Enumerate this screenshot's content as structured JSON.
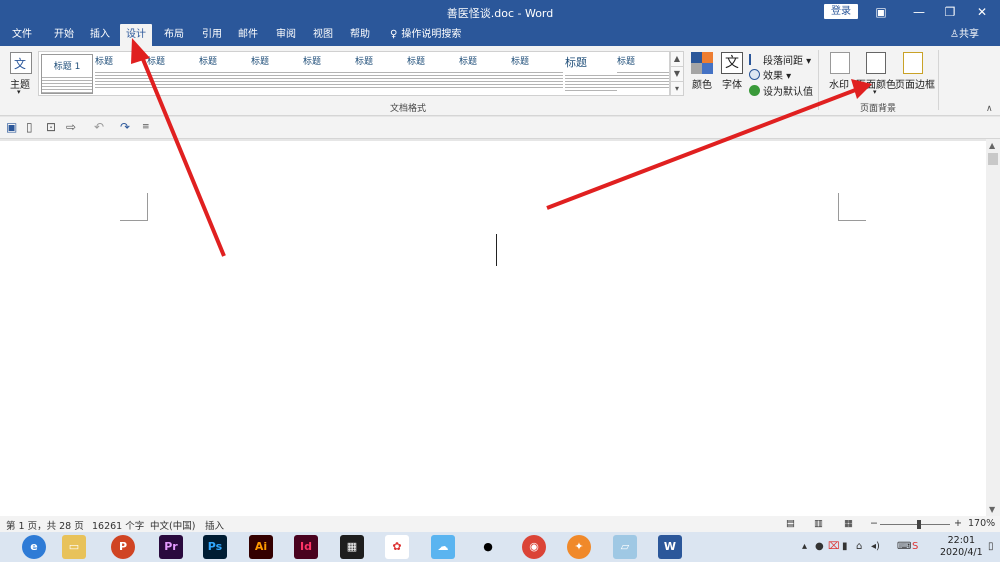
{
  "window": {
    "title": "善医怪谈.doc - Word",
    "login_label": "登录",
    "share_label": "共享"
  },
  "tabs": [
    {
      "label": "文件"
    },
    {
      "label": "开始"
    },
    {
      "label": "插入"
    },
    {
      "label": "设计"
    },
    {
      "label": "布局"
    },
    {
      "label": "引用"
    },
    {
      "label": "邮件"
    },
    {
      "label": "审阅"
    },
    {
      "label": "视图"
    },
    {
      "label": "帮助"
    },
    {
      "label": "操作说明搜索"
    }
  ],
  "active_tab": "设计",
  "ribbon": {
    "theme_label": "主题",
    "document_format_label": "文档格式",
    "style_headings": [
      "标题 1",
      "标题",
      "标题",
      "标题",
      "标题",
      "标题",
      "标题",
      "标题",
      "标题",
      "标题",
      "标题",
      "标题"
    ],
    "colors_label": "颜色",
    "fonts_label": "字体",
    "paragraph_spacing_label": "段落间距",
    "effects_label": "效果",
    "set_default_label": "设为默认值",
    "watermark_label": "水印",
    "page_color_label": "页面颜色",
    "page_borders_label": "页面边框",
    "page_background_label": "页面背景"
  },
  "status_bar": {
    "page_info": "第 1 页，共 28 页",
    "word_count": "16261 个字",
    "language": "中文(中国)",
    "insert_mode": "插入",
    "zoom_value": "170%",
    "zoom_fraction": 0.53
  },
  "taskbar": {
    "apps": [
      "browser",
      "explorer",
      "P",
      "Pr",
      "Ps",
      "Ai",
      "Id",
      "video-editor",
      "media",
      "cloud",
      "qq",
      "chrome",
      "fox",
      "notepad",
      "W"
    ],
    "time": "22:01",
    "date": "2020/4/1"
  },
  "colors": {
    "accent": "#2b579a",
    "annotation_arrow": "#e02020"
  }
}
